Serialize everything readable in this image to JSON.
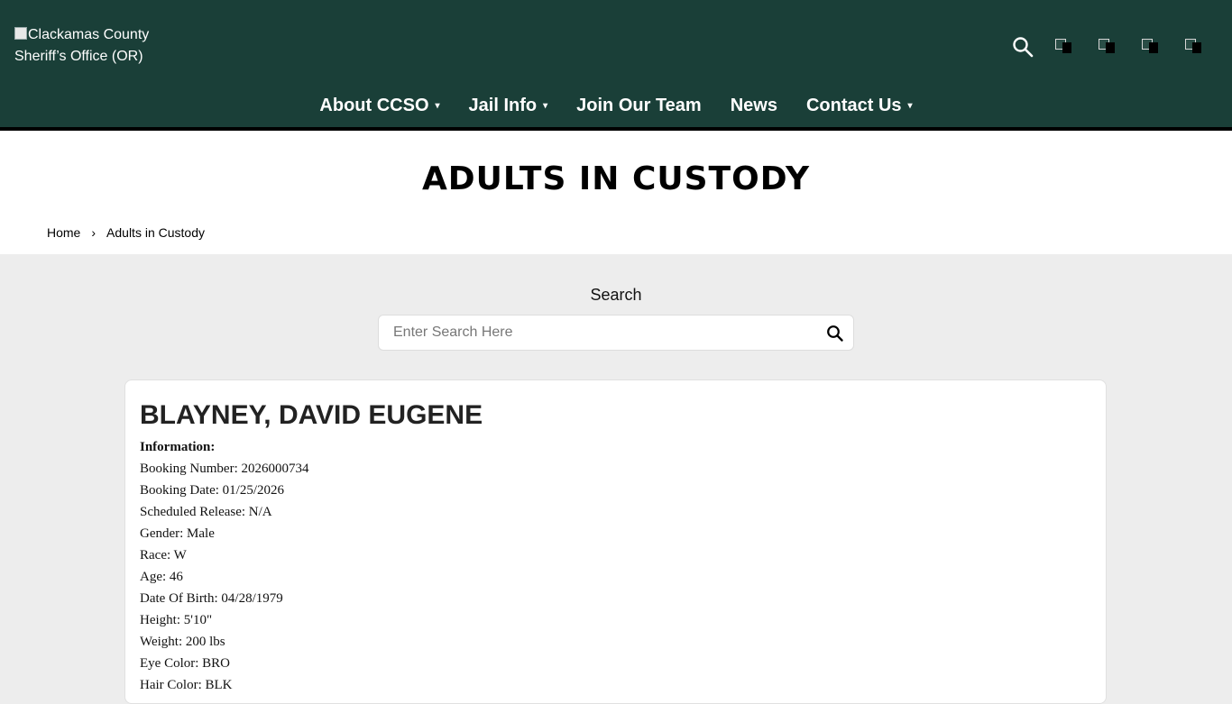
{
  "header": {
    "logo_alt": "Clackamas County Sheriff's Office (OR)",
    "logo_line1": "Clackamas County",
    "logo_line2": "Sheriff’s Office (OR)",
    "icons": [
      "search-icon",
      "social-link-1-icon",
      "social-link-2-icon",
      "social-link-3-icon",
      "social-link-4-icon"
    ]
  },
  "nav": {
    "items": [
      {
        "label": "About CCSO",
        "has_dropdown": true
      },
      {
        "label": "Jail Info",
        "has_dropdown": true
      },
      {
        "label": "Join Our Team",
        "has_dropdown": false
      },
      {
        "label": "News",
        "has_dropdown": false
      },
      {
        "label": "Contact Us",
        "has_dropdown": true
      }
    ],
    "caret": "▾"
  },
  "page": {
    "title": "ADULTS IN CUSTODY",
    "breadcrumb": {
      "home": "Home",
      "separator": "›",
      "current": "Adults in Custody"
    }
  },
  "search": {
    "label": "Search",
    "placeholder": "Enter Search Here",
    "value": ""
  },
  "record": {
    "name": "BLAYNEY, DAVID EUGENE",
    "section_heading": "Information:",
    "fields": [
      "Booking Number: 2026000734",
      "Booking Date: 01/25/2026",
      "Scheduled Release: N/A",
      "Gender: Male",
      "Race: W",
      "Age: 46",
      "Date Of Birth: 04/28/1979",
      "Height: 5'10\"",
      "Weight: 200 lbs",
      "Eye Color: BRO",
      "Hair Color: BLK"
    ]
  },
  "colors": {
    "header_bg": "#1a3f38",
    "page_bg": "#ededed",
    "card_bg": "#ffffff"
  }
}
